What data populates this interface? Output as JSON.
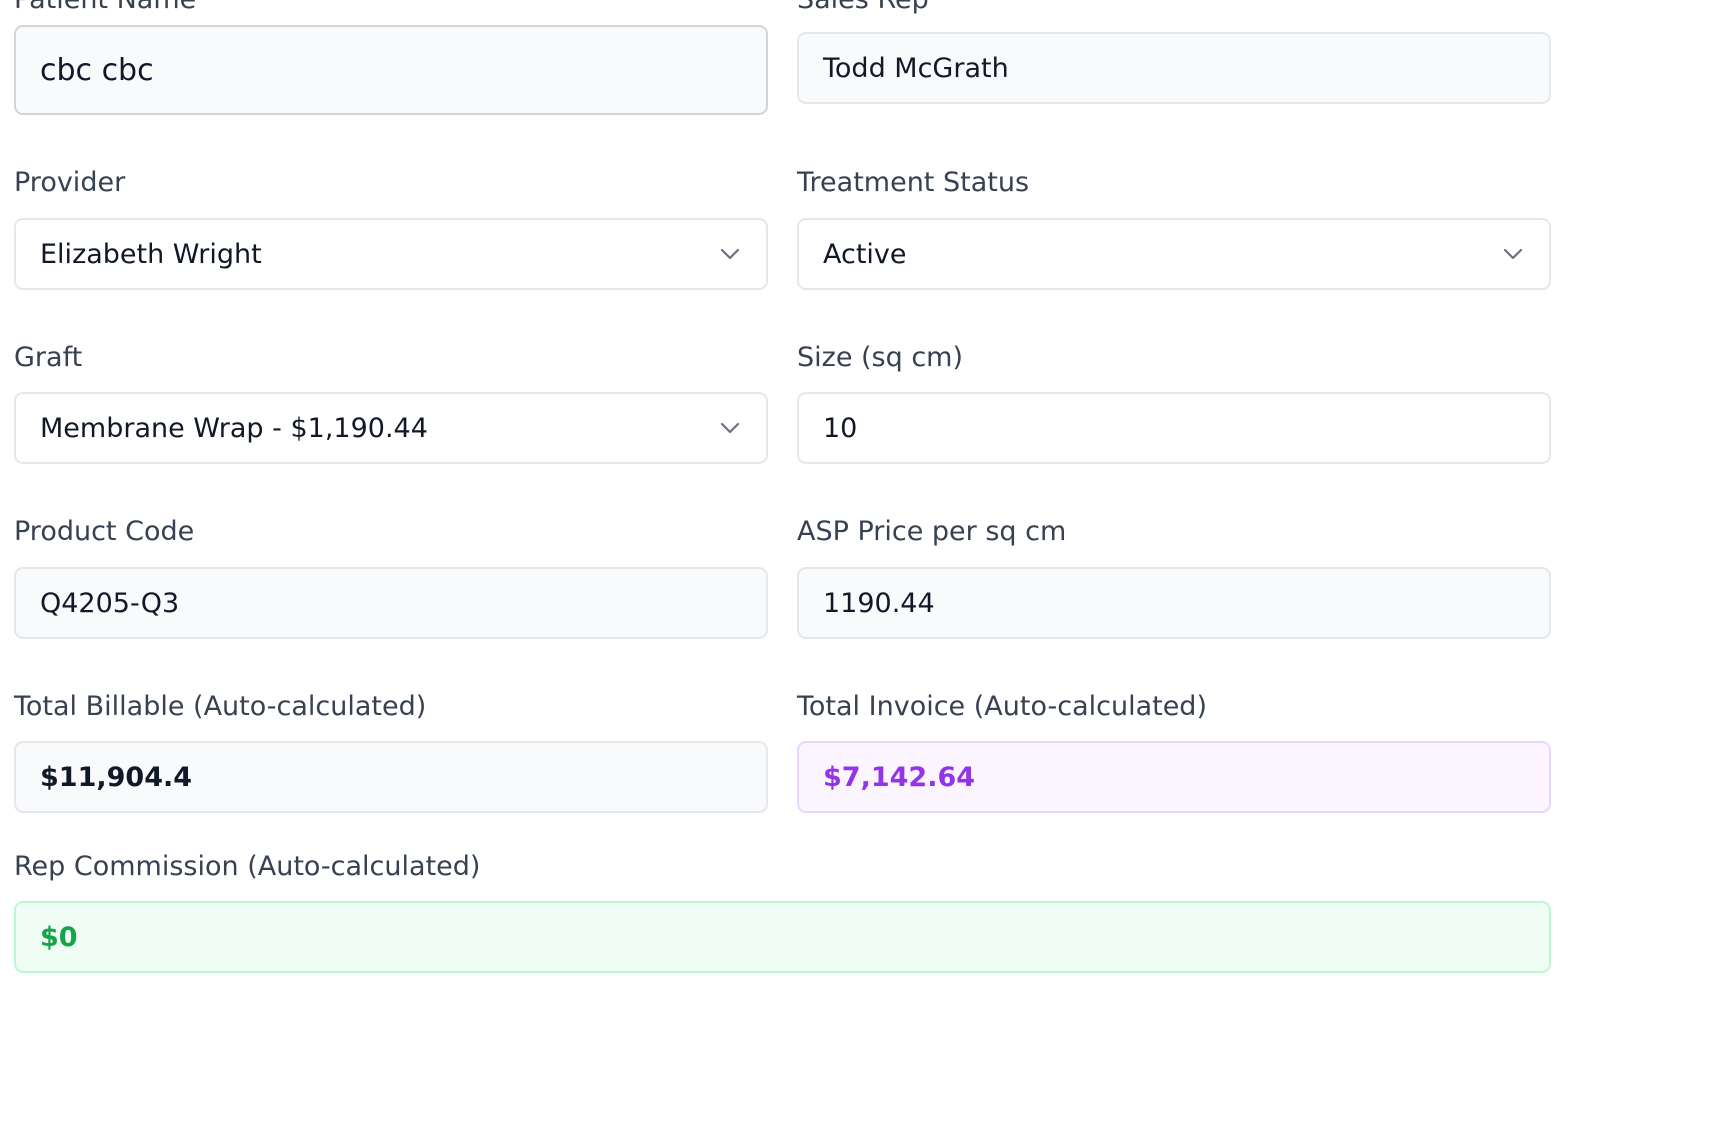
{
  "form": {
    "patient_name": {
      "label": "Patient Name",
      "value": "cbc cbc"
    },
    "sales_rep": {
      "label": "Sales Rep",
      "value": "Todd McGrath"
    },
    "provider": {
      "label": "Provider",
      "value": "Elizabeth Wright",
      "icon": "chevron-down-icon"
    },
    "treatment_status": {
      "label": "Treatment Status",
      "value": "Active",
      "icon": "chevron-down-icon"
    },
    "graft": {
      "label": "Graft",
      "value": "Membrane Wrap - $1,190.44",
      "icon": "chevron-down-icon"
    },
    "size": {
      "label": "Size (sq cm)",
      "value": "10"
    },
    "product_code": {
      "label": "Product Code",
      "value": "Q4205-Q3"
    },
    "asp_price": {
      "label": "ASP Price per sq cm",
      "value": "1190.44"
    },
    "total_billable": {
      "label": "Total Billable (Auto-calculated)",
      "value": "$11,904.4"
    },
    "total_invoice": {
      "label": "Total Invoice (Auto-calculated)",
      "value": "$7,142.64",
      "color": "#9333ea"
    },
    "rep_commission": {
      "label": "Rep Commission (Auto-calculated)",
      "value": "$0",
      "color": "#16a34a"
    }
  }
}
